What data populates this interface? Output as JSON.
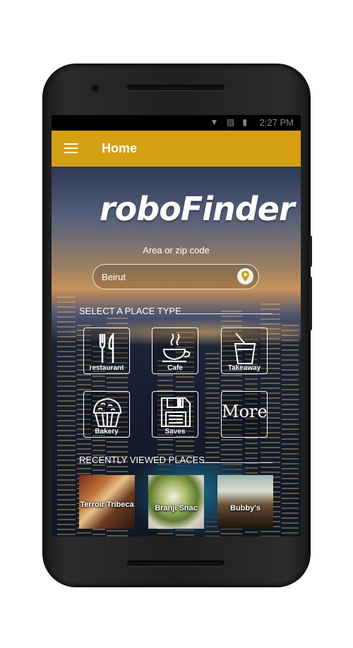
{
  "status_bar": {
    "time": "2:27 PM"
  },
  "app_bar": {
    "title": "Home"
  },
  "logo": "roboFinder",
  "search": {
    "label": "Area or zip code",
    "value": "Beirut"
  },
  "place_types": {
    "heading": "SELECT A PLACE TYPE",
    "items": [
      {
        "label": "restaurant",
        "icon": "fork-knife-icon"
      },
      {
        "label": "Cafe",
        "icon": "coffee-cup-icon"
      },
      {
        "label": "Takeaway",
        "icon": "takeaway-cup-icon"
      },
      {
        "label": "Bakery",
        "icon": "muffin-icon"
      },
      {
        "label": "Saves",
        "icon": "floppy-disk-icon"
      },
      {
        "label": "More",
        "icon": "more-text"
      }
    ]
  },
  "recent": {
    "heading": "RECENTLY VIEWED PLACES",
    "items": [
      {
        "name": "Terroir Tribeca"
      },
      {
        "name": "Branji Snac"
      },
      {
        "name": "Bubby's"
      }
    ]
  },
  "colors": {
    "accent": "#d59f14",
    "pin": "#d59f14"
  }
}
